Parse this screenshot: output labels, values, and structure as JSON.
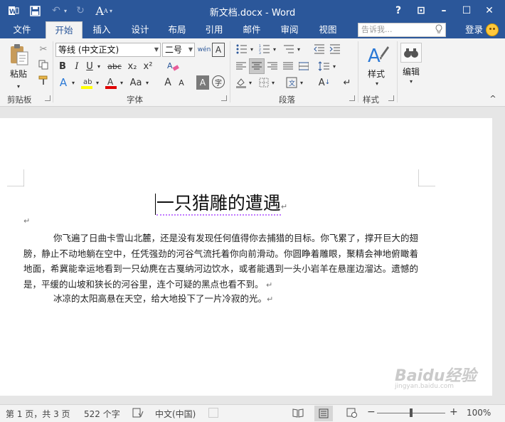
{
  "window": {
    "title": "新文档.docx - Word",
    "help": "?",
    "buttons": {
      "ribbon_options": "⊡",
      "minimize": "–",
      "maximize": "☐",
      "close": "✕"
    }
  },
  "qat": {
    "icons": [
      "word-logo-icon",
      "save-icon",
      "undo-icon",
      "redo-icon",
      "font-size-icon",
      "customize-icon"
    ]
  },
  "tabs": [
    {
      "label": "文件",
      "active": false
    },
    {
      "label": "开始",
      "active": true
    },
    {
      "label": "插入",
      "active": false
    },
    {
      "label": "设计",
      "active": false
    },
    {
      "label": "布局",
      "active": false
    },
    {
      "label": "引用",
      "active": false
    },
    {
      "label": "邮件",
      "active": false
    },
    {
      "label": "审阅",
      "active": false
    },
    {
      "label": "视图",
      "active": false
    }
  ],
  "tellme": {
    "placeholder": "告诉我..."
  },
  "account": {
    "login": "登录"
  },
  "ribbon": {
    "clipboard": {
      "label": "剪贴板",
      "paste": "粘贴"
    },
    "font": {
      "label": "字体",
      "font_name": "等线 (中文正文)",
      "font_size": "二号",
      "bold": "B",
      "italic": "I",
      "underline": "U",
      "strikethrough": "abc",
      "subscript": "x₂",
      "superscript": "x²",
      "case": "Aa",
      "grow": "A",
      "shrink": "A"
    },
    "paragraph": {
      "label": "段落"
    },
    "styles": {
      "label": "样式",
      "button": "样式"
    },
    "editing": {
      "button": "编辑"
    }
  },
  "document": {
    "title": "一只猎雕的遭遇",
    "paragraphs": [
      "你飞遍了日曲卡雪山北麓，还是没有发现任何值得你去捕猎的目标。你飞累了，撑开巨大的翅膀，静止不动地躺在空中，任凭强劲的河谷气流托着你向前滑动。你圆睁着雕眼，聚精会神地俯瞰着地面，希冀能幸运地看到一只幼麂在古戛纳河边饮水，或者能遇到一头小岩羊在悬崖边溜达。遗憾的是，平缓的山坡和狭长的河谷里，连个可疑的黑点也看不到。",
      "冰凉的太阳高悬在天空，给大地投下了一片冷寂的光。"
    ]
  },
  "status": {
    "page": "第 1 页，共 3 页",
    "words": "522 个字",
    "language": "中文(中国)",
    "zoom_out": "−",
    "zoom_in": "+",
    "zoom": "100%"
  },
  "watermark": {
    "brand": "Baidu经验",
    "url": "jingyan.baidu.com"
  },
  "colors": {
    "title_bar": "#2b579a",
    "ribbon": "#f3f3f3",
    "page": "#ffffff",
    "highlight": "#ffff00",
    "font_color": "#e00000"
  }
}
